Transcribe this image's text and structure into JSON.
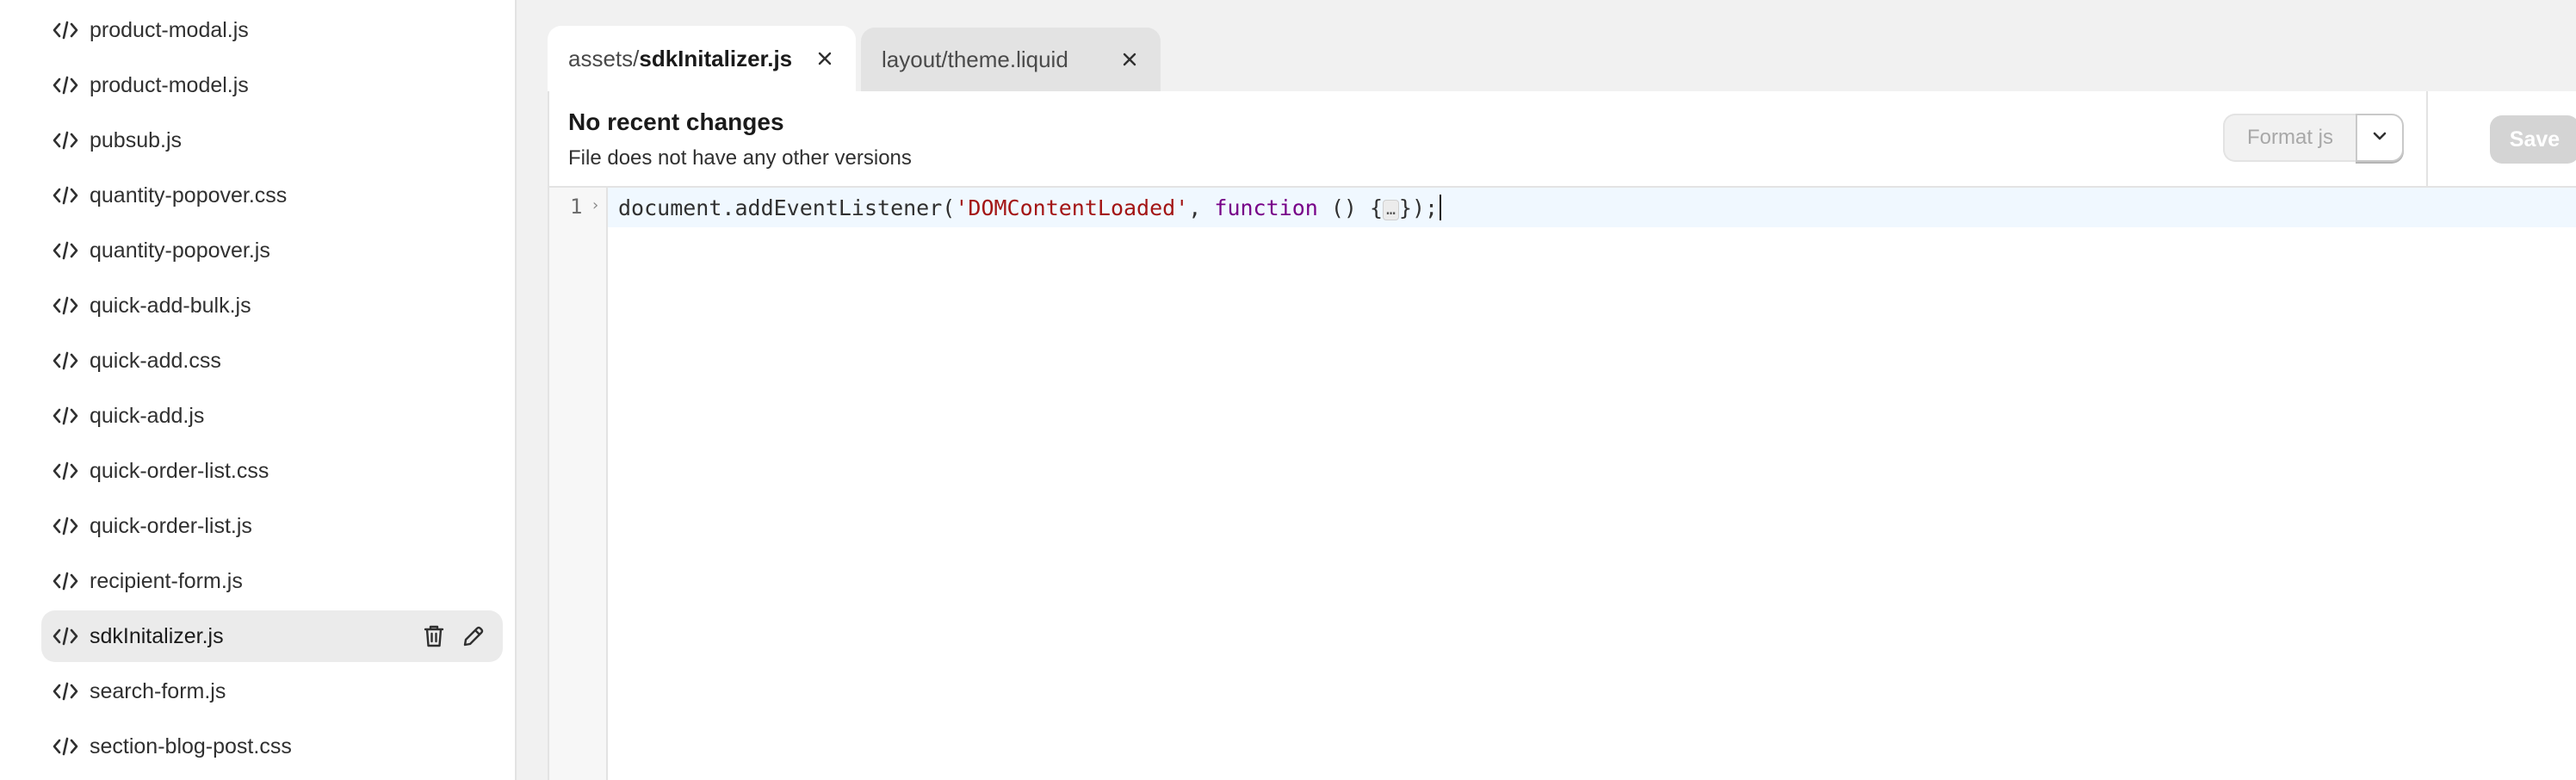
{
  "sidebar": {
    "items": [
      {
        "label": "product-modal.js"
      },
      {
        "label": "product-model.js"
      },
      {
        "label": "pubsub.js"
      },
      {
        "label": "quantity-popover.css"
      },
      {
        "label": "quantity-popover.js"
      },
      {
        "label": "quick-add-bulk.js"
      },
      {
        "label": "quick-add.css"
      },
      {
        "label": "quick-add.js"
      },
      {
        "label": "quick-order-list.css"
      },
      {
        "label": "quick-order-list.js"
      },
      {
        "label": "recipient-form.js"
      },
      {
        "label": "sdkInitalizer.js",
        "active": true
      },
      {
        "label": "search-form.js"
      },
      {
        "label": "section-blog-post.css"
      }
    ]
  },
  "tabs": [
    {
      "prefix": "assets/",
      "name": "sdkInitalizer.js",
      "active": true
    },
    {
      "label": "layout/theme.liquid",
      "active": false
    }
  ],
  "header": {
    "title": "No recent changes",
    "subtitle": "File does not have any other versions",
    "format_label": "Format js",
    "save_label": "Save"
  },
  "editor": {
    "line_number": "1",
    "fold_marker": "›",
    "code": {
      "part1": "document.addEventListener(",
      "string": "'DOMContentLoaded'",
      "part2": ", ",
      "keyword": "function",
      "part3": " () {",
      "ellipsis": "…",
      "part4": "});"
    }
  },
  "colors": {
    "sidebar_active": "#ebebeb",
    "string": "#a31515",
    "keyword": "#770088",
    "save_disabled": "#d4d4d4"
  }
}
